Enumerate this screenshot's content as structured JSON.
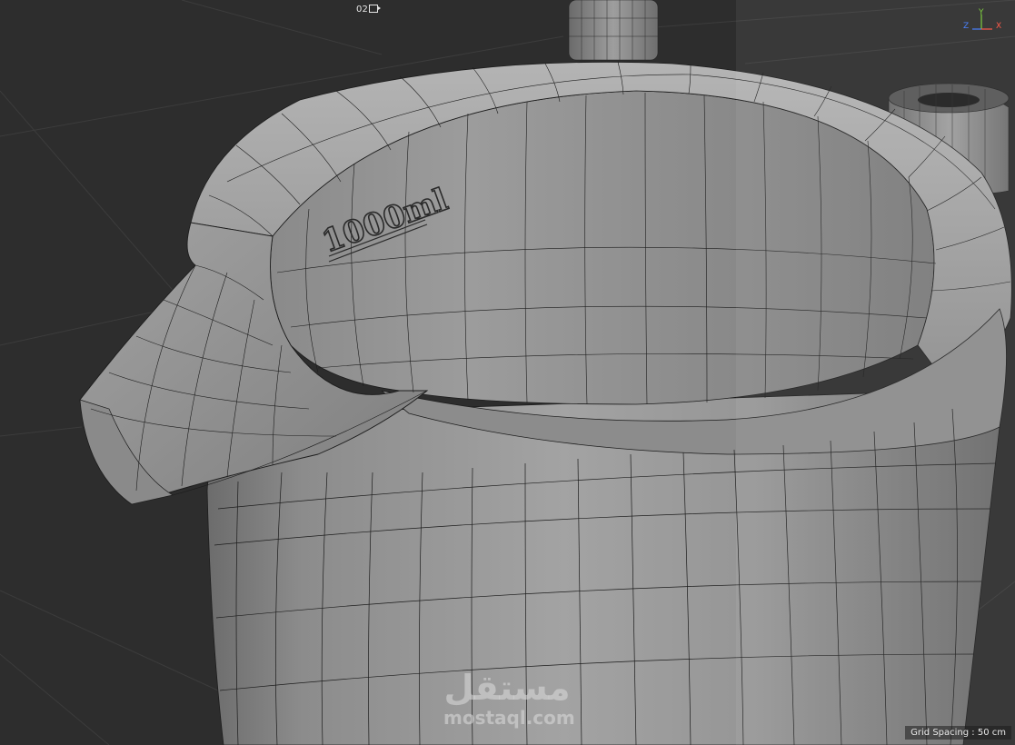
{
  "viewport": {
    "camera_label": "02",
    "grid_spacing_text": "Grid Spacing : 50 cm",
    "background_color": "#2d2d2d"
  },
  "model": {
    "engraving_text": "1000ml",
    "surface_color": "#9a9a9a",
    "wire_color": "#1a1a1a"
  },
  "axis": {
    "y_label": "Y",
    "z_label": "Z",
    "x_label": "X",
    "y_color": "#7fcf3f",
    "z_color": "#4a82ff",
    "x_color": "#ff5a4a"
  },
  "watermark": {
    "arabic": "مستقل",
    "latin": "mostaql.com"
  }
}
